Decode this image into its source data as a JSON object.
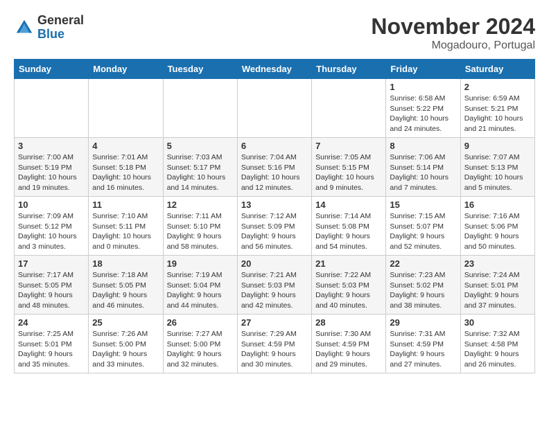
{
  "logo": {
    "general": "General",
    "blue": "Blue"
  },
  "title": "November 2024",
  "location": "Mogadouro, Portugal",
  "days_of_week": [
    "Sunday",
    "Monday",
    "Tuesday",
    "Wednesday",
    "Thursday",
    "Friday",
    "Saturday"
  ],
  "weeks": [
    [
      {
        "day": "",
        "info": ""
      },
      {
        "day": "",
        "info": ""
      },
      {
        "day": "",
        "info": ""
      },
      {
        "day": "",
        "info": ""
      },
      {
        "day": "",
        "info": ""
      },
      {
        "day": "1",
        "info": "Sunrise: 6:58 AM\nSunset: 5:22 PM\nDaylight: 10 hours\nand 24 minutes."
      },
      {
        "day": "2",
        "info": "Sunrise: 6:59 AM\nSunset: 5:21 PM\nDaylight: 10 hours\nand 21 minutes."
      }
    ],
    [
      {
        "day": "3",
        "info": "Sunrise: 7:00 AM\nSunset: 5:19 PM\nDaylight: 10 hours\nand 19 minutes."
      },
      {
        "day": "4",
        "info": "Sunrise: 7:01 AM\nSunset: 5:18 PM\nDaylight: 10 hours\nand 16 minutes."
      },
      {
        "day": "5",
        "info": "Sunrise: 7:03 AM\nSunset: 5:17 PM\nDaylight: 10 hours\nand 14 minutes."
      },
      {
        "day": "6",
        "info": "Sunrise: 7:04 AM\nSunset: 5:16 PM\nDaylight: 10 hours\nand 12 minutes."
      },
      {
        "day": "7",
        "info": "Sunrise: 7:05 AM\nSunset: 5:15 PM\nDaylight: 10 hours\nand 9 minutes."
      },
      {
        "day": "8",
        "info": "Sunrise: 7:06 AM\nSunset: 5:14 PM\nDaylight: 10 hours\nand 7 minutes."
      },
      {
        "day": "9",
        "info": "Sunrise: 7:07 AM\nSunset: 5:13 PM\nDaylight: 10 hours\nand 5 minutes."
      }
    ],
    [
      {
        "day": "10",
        "info": "Sunrise: 7:09 AM\nSunset: 5:12 PM\nDaylight: 10 hours\nand 3 minutes."
      },
      {
        "day": "11",
        "info": "Sunrise: 7:10 AM\nSunset: 5:11 PM\nDaylight: 10 hours\nand 0 minutes."
      },
      {
        "day": "12",
        "info": "Sunrise: 7:11 AM\nSunset: 5:10 PM\nDaylight: 9 hours\nand 58 minutes."
      },
      {
        "day": "13",
        "info": "Sunrise: 7:12 AM\nSunset: 5:09 PM\nDaylight: 9 hours\nand 56 minutes."
      },
      {
        "day": "14",
        "info": "Sunrise: 7:14 AM\nSunset: 5:08 PM\nDaylight: 9 hours\nand 54 minutes."
      },
      {
        "day": "15",
        "info": "Sunrise: 7:15 AM\nSunset: 5:07 PM\nDaylight: 9 hours\nand 52 minutes."
      },
      {
        "day": "16",
        "info": "Sunrise: 7:16 AM\nSunset: 5:06 PM\nDaylight: 9 hours\nand 50 minutes."
      }
    ],
    [
      {
        "day": "17",
        "info": "Sunrise: 7:17 AM\nSunset: 5:05 PM\nDaylight: 9 hours\nand 48 minutes."
      },
      {
        "day": "18",
        "info": "Sunrise: 7:18 AM\nSunset: 5:05 PM\nDaylight: 9 hours\nand 46 minutes."
      },
      {
        "day": "19",
        "info": "Sunrise: 7:19 AM\nSunset: 5:04 PM\nDaylight: 9 hours\nand 44 minutes."
      },
      {
        "day": "20",
        "info": "Sunrise: 7:21 AM\nSunset: 5:03 PM\nDaylight: 9 hours\nand 42 minutes."
      },
      {
        "day": "21",
        "info": "Sunrise: 7:22 AM\nSunset: 5:03 PM\nDaylight: 9 hours\nand 40 minutes."
      },
      {
        "day": "22",
        "info": "Sunrise: 7:23 AM\nSunset: 5:02 PM\nDaylight: 9 hours\nand 38 minutes."
      },
      {
        "day": "23",
        "info": "Sunrise: 7:24 AM\nSunset: 5:01 PM\nDaylight: 9 hours\nand 37 minutes."
      }
    ],
    [
      {
        "day": "24",
        "info": "Sunrise: 7:25 AM\nSunset: 5:01 PM\nDaylight: 9 hours\nand 35 minutes."
      },
      {
        "day": "25",
        "info": "Sunrise: 7:26 AM\nSunset: 5:00 PM\nDaylight: 9 hours\nand 33 minutes."
      },
      {
        "day": "26",
        "info": "Sunrise: 7:27 AM\nSunset: 5:00 PM\nDaylight: 9 hours\nand 32 minutes."
      },
      {
        "day": "27",
        "info": "Sunrise: 7:29 AM\nSunset: 4:59 PM\nDaylight: 9 hours\nand 30 minutes."
      },
      {
        "day": "28",
        "info": "Sunrise: 7:30 AM\nSunset: 4:59 PM\nDaylight: 9 hours\nand 29 minutes."
      },
      {
        "day": "29",
        "info": "Sunrise: 7:31 AM\nSunset: 4:59 PM\nDaylight: 9 hours\nand 27 minutes."
      },
      {
        "day": "30",
        "info": "Sunrise: 7:32 AM\nSunset: 4:58 PM\nDaylight: 9 hours\nand 26 minutes."
      }
    ]
  ]
}
